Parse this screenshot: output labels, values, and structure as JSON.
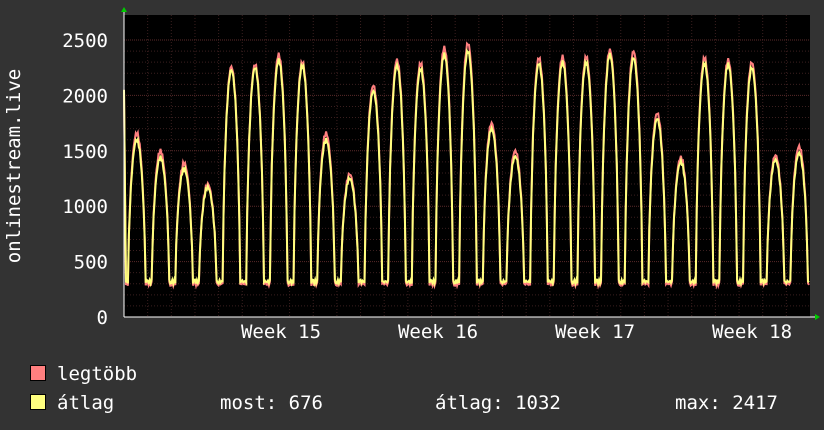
{
  "chart_data": {
    "type": "line",
    "ylabel": "onlinestream.live",
    "ylim": [
      0,
      2500
    ],
    "y_ticks": [
      0,
      500,
      1000,
      1500,
      2000,
      2500
    ],
    "x_ticks": [
      "Week 15",
      "Week 16",
      "Week 17",
      "Week 18"
    ],
    "grid": true,
    "days": 29,
    "series": [
      {
        "name": "legtöbb",
        "color": "#ff7f7f",
        "daily_peaks": [
          1660,
          1500,
          1390,
          1200,
          2260,
          2280,
          2370,
          2300,
          1660,
          1290,
          2090,
          2320,
          2290,
          2430,
          2470,
          1750,
          1500,
          2340,
          2350,
          2350,
          2410,
          2400,
          1840,
          1440,
          2340,
          2320,
          2300,
          1460,
          1540
        ],
        "daily_min": 300
      },
      {
        "name": "átlag",
        "color": "#ffff7f",
        "daily_peaks": [
          1600,
          1440,
          1340,
          1170,
          2230,
          2250,
          2320,
          2270,
          1600,
          1250,
          2040,
          2270,
          2240,
          2370,
          2400,
          1700,
          1450,
          2290,
          2300,
          2300,
          2370,
          2340,
          1790,
          1400,
          2290,
          2280,
          2250,
          1420,
          1480
        ],
        "daily_min": 320
      }
    ]
  },
  "legend": [
    {
      "label": "legtöbb",
      "color": "#ff7f7f"
    },
    {
      "label": "átlag",
      "color": "#ffff7f"
    }
  ],
  "stats": {
    "current": "most: 676",
    "average": "átlag: 1032",
    "max": "max: 2417"
  }
}
